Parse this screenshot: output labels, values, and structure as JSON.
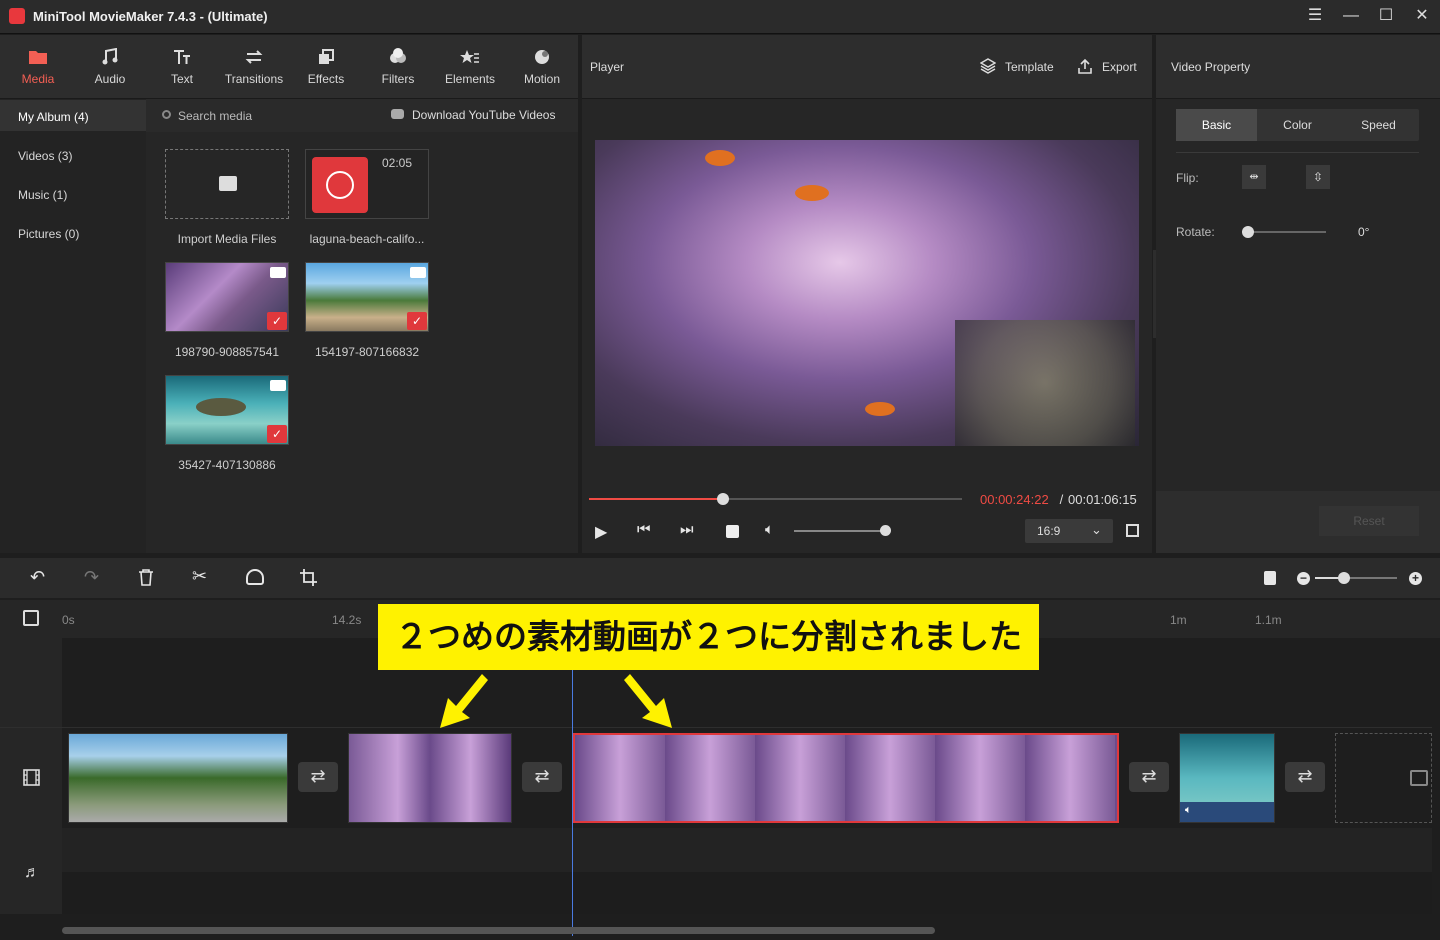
{
  "window": {
    "title": "MiniTool MovieMaker 7.4.3 - (Ultimate)"
  },
  "toolbar": {
    "items": [
      {
        "label": "Media",
        "icon": "folder-icon"
      },
      {
        "label": "Audio",
        "icon": "music-note-icon"
      },
      {
        "label": "Text",
        "icon": "text-icon"
      },
      {
        "label": "Transitions",
        "icon": "swap-arrows-icon"
      },
      {
        "label": "Effects",
        "icon": "layers-icon"
      },
      {
        "label": "Filters",
        "icon": "filters-icon"
      },
      {
        "label": "Elements",
        "icon": "star-icon"
      },
      {
        "label": "Motion",
        "icon": "motion-icon"
      }
    ],
    "active_color": "#f35f54"
  },
  "library": {
    "side_items": [
      "My Album (4)",
      "Videos (3)",
      "Music (1)",
      "Pictures (0)"
    ],
    "search_placeholder": "Search media",
    "download_label": "Download YouTube Videos",
    "import_label": "Import Media Files",
    "audio_duration": "02:05",
    "audio_name": "laguna-beach-califo...",
    "videos": [
      "198790-908857541",
      "154197-807166832",
      "35427-407130886"
    ]
  },
  "player": {
    "title": "Player",
    "template_label": "Template",
    "export_label": "Export",
    "time_current": "00:00:24:22",
    "time_separator": " / ",
    "time_total": "00:01:06:15",
    "progress": 0.36,
    "volume": 0.95,
    "aspect": "16:9"
  },
  "properties": {
    "title": "Video Property",
    "tabs": [
      "Basic",
      "Color",
      "Speed"
    ],
    "flip_label": "Flip:",
    "rotate_label": "Rotate:",
    "rotate_value": "0°",
    "reset_label": "Reset"
  },
  "timeline": {
    "ruler_labels": [
      "0s",
      "14.2s",
      "1m",
      "1.1m"
    ],
    "zoom": 0.35
  },
  "annotation": {
    "text": "２つめの素材動画が２つに分割されました",
    "color": "#fff200"
  }
}
